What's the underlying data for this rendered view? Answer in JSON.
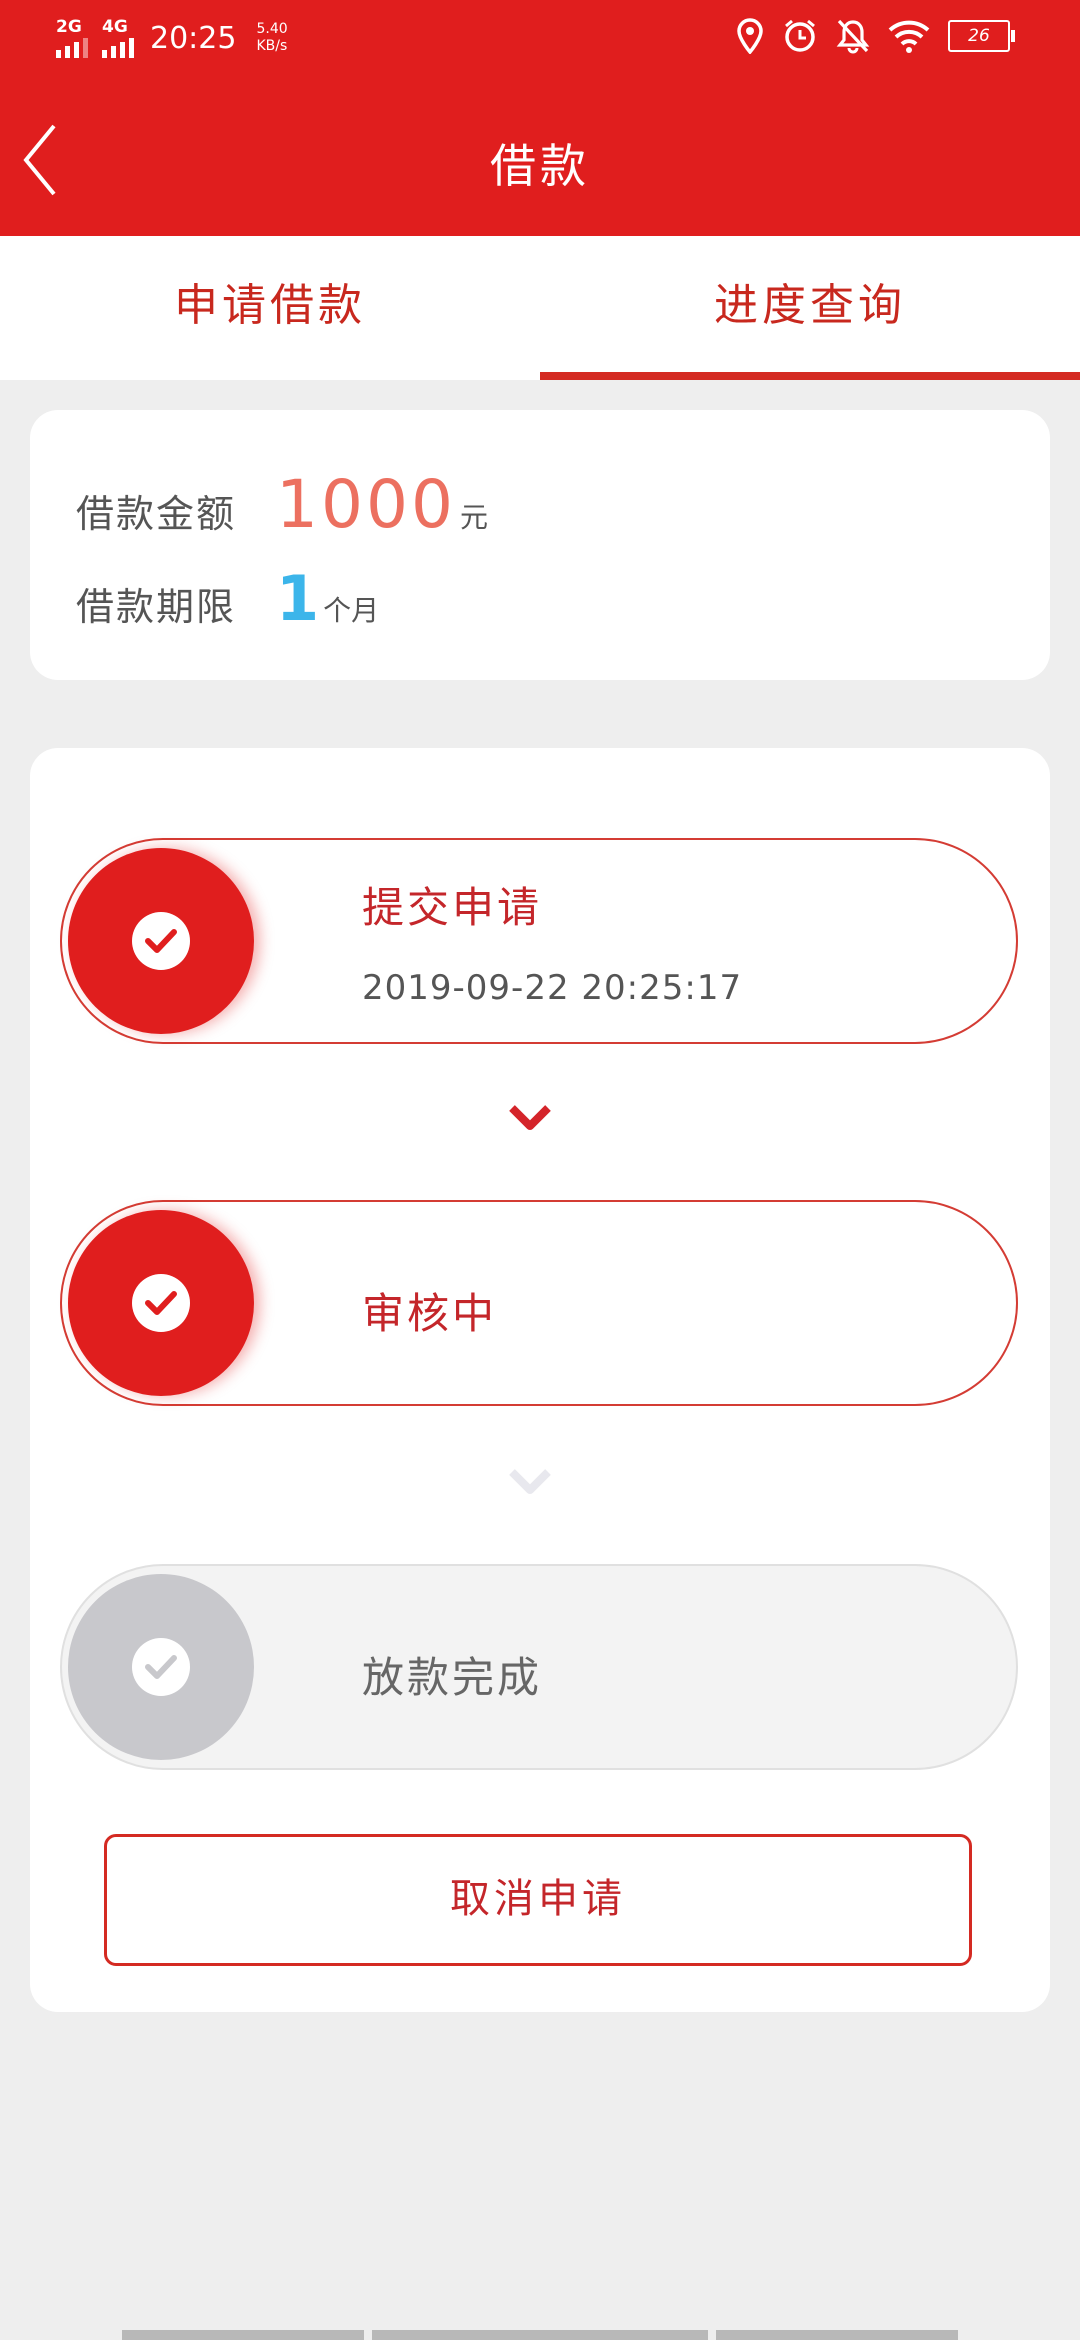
{
  "status_bar": {
    "signal1": "2G",
    "signal2": "4G",
    "time": "20:25",
    "speed_value": "5.40",
    "speed_unit": "KB/s",
    "battery": "26",
    "icons": [
      "location-icon",
      "alarm-icon",
      "bell-off-icon",
      "wifi-icon",
      "battery-icon"
    ]
  },
  "header": {
    "title": "借款",
    "back_icon": "chevron-left-icon"
  },
  "tabs": [
    {
      "label": "申请借款",
      "active": false
    },
    {
      "label": "进度查询",
      "active": true
    }
  ],
  "loan_summary": {
    "amount_label": "借款金额",
    "amount_value": "1000",
    "amount_unit": "元",
    "term_label": "借款期限",
    "term_value": "1",
    "term_unit": "个月"
  },
  "progress": {
    "steps": [
      {
        "title": "提交申请",
        "time": "2019-09-22 20:25:17",
        "state": "done"
      },
      {
        "title": "审核中",
        "state": "done"
      },
      {
        "title": "放款完成",
        "state": "pending"
      }
    ],
    "cancel_label": "取消申请"
  },
  "colors": {
    "brand": "#e01e1e",
    "amount": "#ec7060",
    "term": "#3cb5ea",
    "pending": "#c8c8cc"
  }
}
